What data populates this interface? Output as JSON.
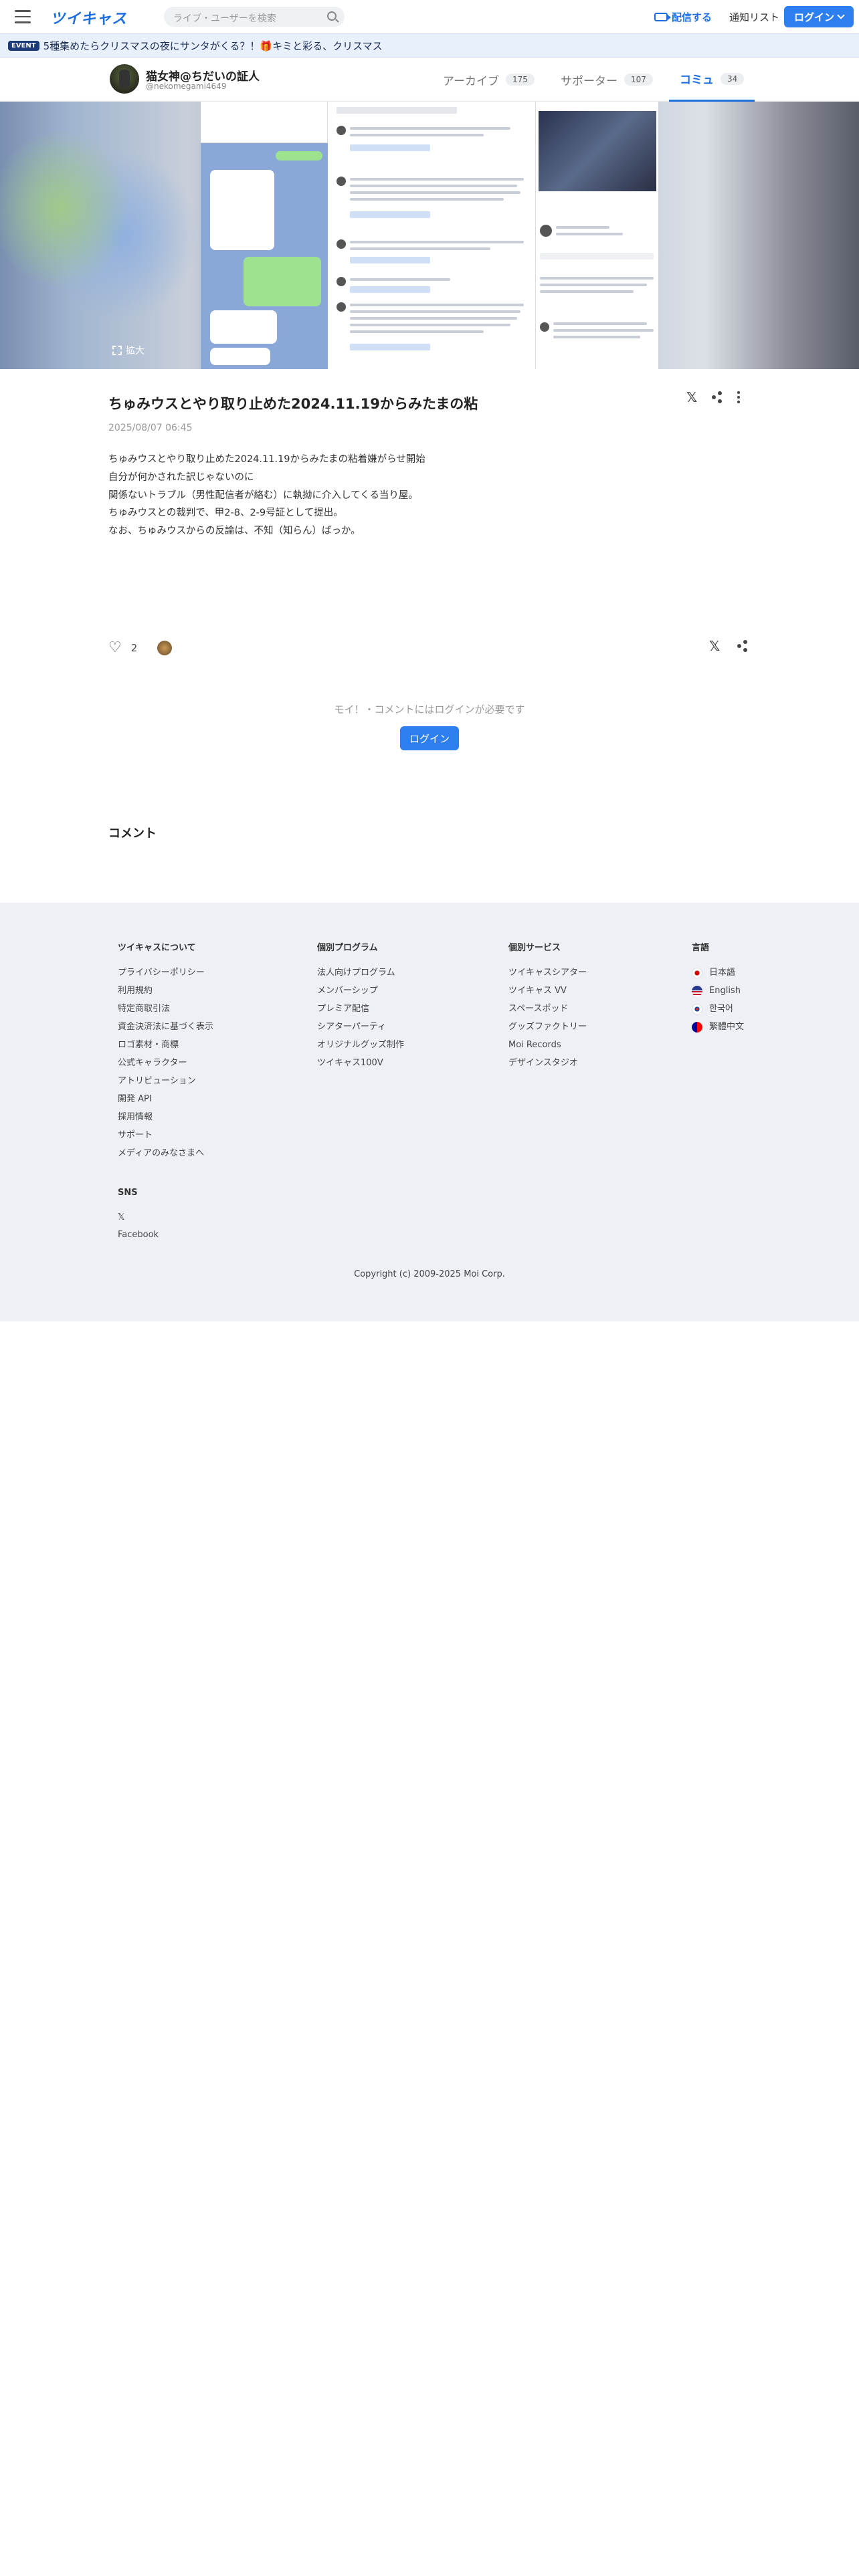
{
  "header": {
    "logo": "ツイキャス",
    "search_placeholder": "ライブ・ユーザーを検索",
    "broadcast_label": "配信する",
    "notify_label": "通知リスト",
    "login_label": "ログイン"
  },
  "event": {
    "badge": "EVENT",
    "text": "5種集めたらクリスマスの夜にサンタがくる？！🎁キミと彩る、クリスマス"
  },
  "profile": {
    "name": "猫女神@ちだいの証人",
    "username": "@nekomegami4649",
    "tabs": [
      {
        "label": "アーカイブ",
        "count": "175"
      },
      {
        "label": "サポーター",
        "count": "107"
      },
      {
        "label": "コミュ",
        "count": "34"
      }
    ]
  },
  "hero": {
    "expand_label": "拡大"
  },
  "post": {
    "title": "ちゅみウスとやり取り止めた2024.11.19からみたまの粘",
    "date": "2025/08/07 06:45",
    "body": [
      "ちゅみウスとやり取り止めた2024.11.19からみたまの粘着嫌がらせ開始",
      "",
      "自分が何かされた訳じゃないのに",
      "関係ないトラブル（男性配信者が絡む）に執拗に介入してくる当り屋。",
      "",
      "ちゅみウスとの裁判で、甲2-8、2-9号証として提出。",
      "",
      "なお、ちゅみウスからの反論は、不知（知らん）ばっか。"
    ],
    "like_count": "2"
  },
  "login_note": "モイ！・コメントにはログインが必要です",
  "login_button": "ログイン",
  "comment_heading": "コメント",
  "footer": {
    "about": {
      "heading": "ツイキャスについて",
      "links": [
        "プライバシーポリシー",
        "利用規約",
        "特定商取引法",
        "資金決済法に基づく表示",
        "ロゴ素材・商標",
        "公式キャラクター",
        "アトリビューション",
        "開発 API",
        "採用情報",
        "サポート",
        "メディアのみなさまへ"
      ]
    },
    "programs": {
      "heading": "個別プログラム",
      "links": [
        "法人向けプログラム",
        "メンバーシップ",
        "プレミア配信",
        "シアターパーティ",
        "オリジナルグッズ制作",
        "ツイキャス100V"
      ]
    },
    "services": {
      "heading": "個別サービス",
      "links": [
        "ツイキャスシアター",
        "ツイキャス VV",
        "スペースポッド",
        "グッズファクトリー",
        "Moi Records",
        "デザインスタジオ"
      ]
    },
    "languages": {
      "heading": "言語",
      "items": [
        {
          "label": "日本語",
          "flag": "japan-flag-icon"
        },
        {
          "label": "English",
          "flag": "us-flag-icon"
        },
        {
          "label": "한국어",
          "flag": "korea-flag-icon"
        },
        {
          "label": "繁體中文",
          "flag": "taiwan-flag-icon"
        }
      ]
    },
    "sns": {
      "heading": "SNS",
      "links": [
        "𝕏",
        "Facebook"
      ]
    },
    "copyright": "Copyright (c) 2009-2025 Moi Corp."
  },
  "colors": {
    "accent": "#2d7ff0",
    "footer_bg": "#eef0f6",
    "event_bg": "#e8f0fb"
  }
}
